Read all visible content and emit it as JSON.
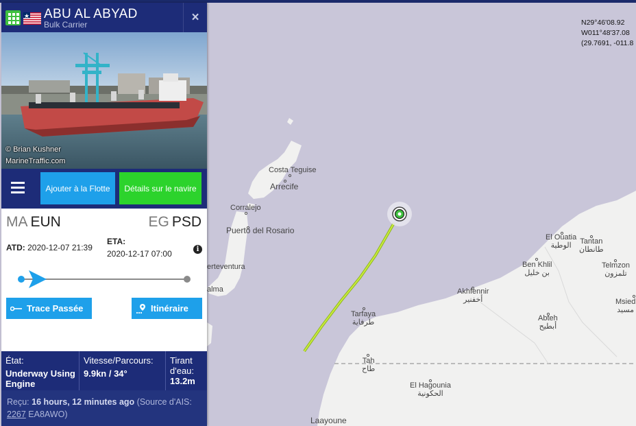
{
  "vessel": {
    "name": "ABU AL ABYAD",
    "type": "Bulk Carrier",
    "photo_credit_1": "© Brian Kushner",
    "photo_credit_2": "MarineTraffic.com"
  },
  "actions": {
    "add_fleet": "Ajouter à la Flotte",
    "details": "Détails sur le navire"
  },
  "voyage": {
    "from_country": "MA",
    "from_port": "EUN",
    "to_country": "EG",
    "to_port": "PSD",
    "atd_label": "ATD:",
    "atd_value": "2020-12-07 21:39",
    "eta_label": "ETA:",
    "eta_value": "2020-12-17 07:00",
    "progress_fraction": 0.04
  },
  "buttons": {
    "trace": "Trace Passée",
    "route": "Itinéraire"
  },
  "status": {
    "state_label": "État:",
    "state_value": "Underway Using Engine",
    "speed_label": "Vitesse/Parcours:",
    "speed_value": "9.9kn / 34°",
    "draught_label": "Tirant d'eau:",
    "draught_value": "13.2m"
  },
  "received": {
    "prefix": "Reçu:",
    "ago": "16 hours, 12 minutes ago",
    "source_prefix": "(Source d'AIS:",
    "source_id": "2267",
    "source_suffix": "EA8AWO)"
  },
  "map": {
    "coord_1": "N29°46'08.92",
    "coord_2": "W011°48'37.08",
    "coord_3": "(29.7691, -011.8",
    "places": {
      "costa_teguise": "Costa Teguise",
      "arrecife": "Arrecife",
      "corralejo": "Corralejo",
      "puerto_del_rosario": "Puerto del Rosario",
      "fuerteventura": "erteventura",
      "jandia": "alma",
      "tarfaya": "Tarfaya",
      "tarfaya_ar": "طرفاية",
      "el_ouatia": "El Ouatia",
      "el_ouatia_ar": "الوطية",
      "tantan": "Tantan",
      "tantan_ar": "طانطان",
      "ben_khlil": "Ben Khlil",
      "ben_khlil_ar": "بن خليل",
      "telmzon": "Telmzon",
      "telmzon_ar": "تلمزون",
      "akhfennir": "Akhfennir",
      "akhfennir_ar": "أخفنير",
      "msied": "Msied",
      "msied_ar": "مسيد",
      "abteh": "Abteh",
      "abteh_ar": "أبطيح",
      "tah": "Tah",
      "tah_ar": "طاح",
      "el_hagounia": "El Hagounia",
      "el_hagounia_ar": "الحكونية",
      "laayoune": "Laayoune"
    }
  },
  "colors": {
    "header": "#1d2c78",
    "accent_blue": "#1ea0ea",
    "accent_green": "#2cd32c",
    "sea": "#c9c6d9",
    "land": "#f1f1f1",
    "track": "#b4e62c"
  }
}
